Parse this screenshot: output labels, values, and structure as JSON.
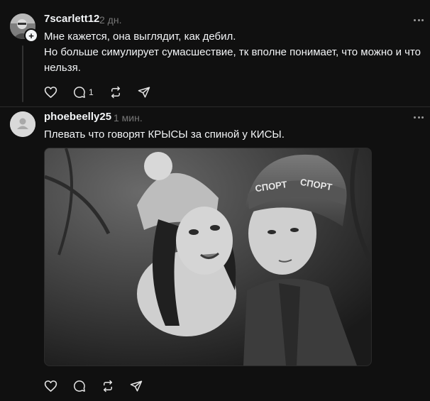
{
  "posts": [
    {
      "username": "7scarlett12",
      "time": "2 дн.",
      "text_lines": [
        "Мне кажется, она выглядит, как дебил.",
        "Но больше симулирует сумасшествие, тк вполне понимает, что можно и что",
        "нельзя."
      ],
      "follow_badge": "+",
      "reply_count": "1",
      "icons": [
        "heart-icon",
        "comment-icon",
        "repost-icon",
        "share-icon"
      ]
    },
    {
      "username": "phoebeelly25",
      "time": "1 мин.",
      "text": "Плевать что говорят КРЫСЫ за спиной у КИСЫ.",
      "image": {
        "hat_text": "СПОРТ"
      },
      "icons": [
        "heart-icon",
        "comment-icon",
        "repost-icon",
        "share-icon"
      ]
    }
  ],
  "colors": {
    "background": "#101010",
    "text": "#f3f5f7",
    "muted": "#777777",
    "divider": "#2a2a2a"
  }
}
